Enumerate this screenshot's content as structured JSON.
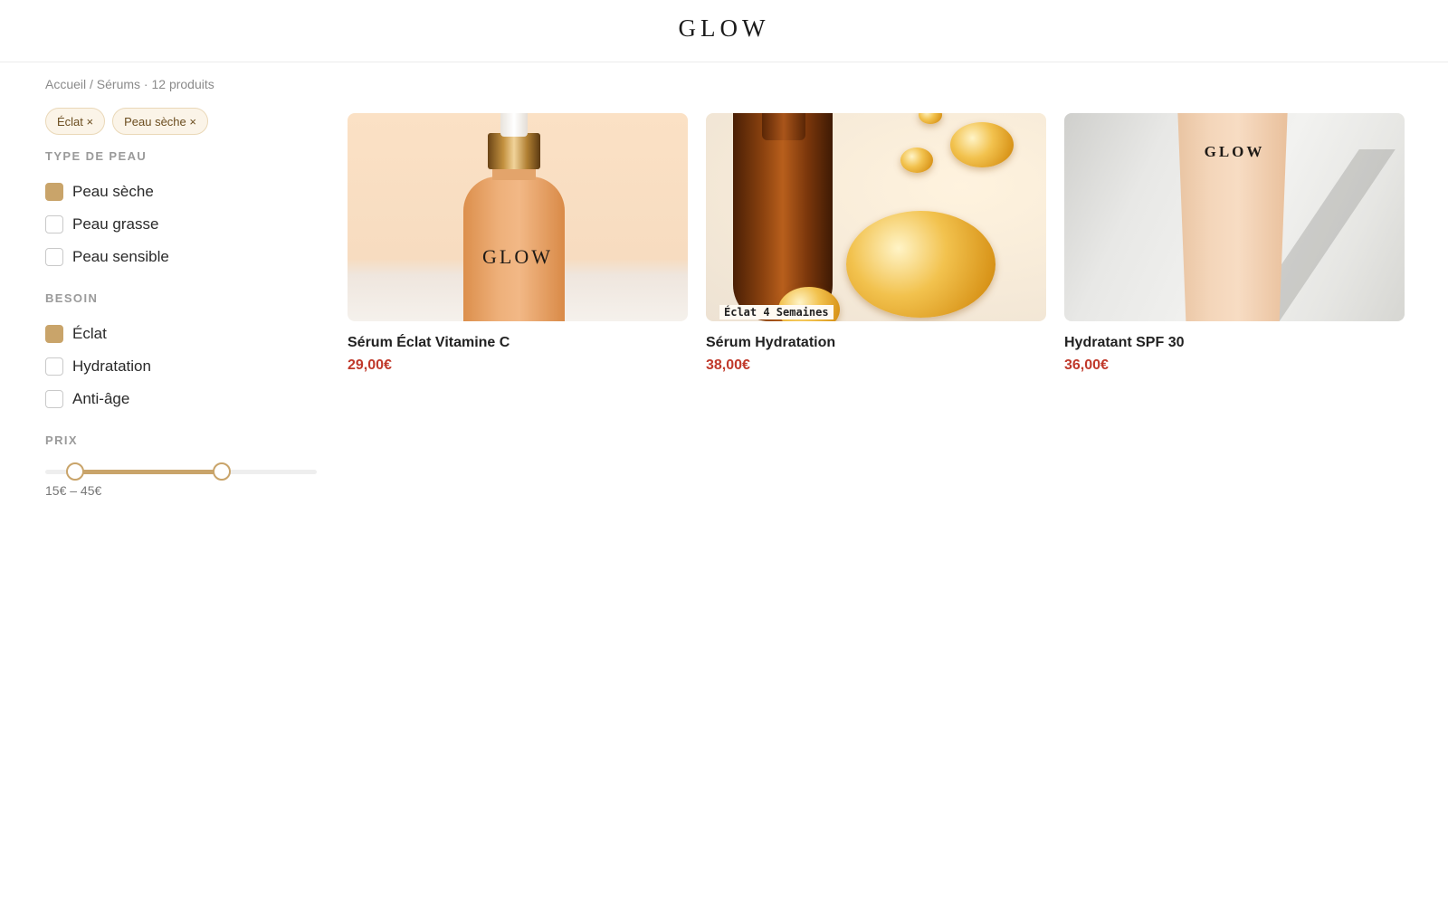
{
  "header": {
    "logo": "GLOW"
  },
  "breadcrumb": "Accueil / Sérums · 12 produits",
  "active_filters": [
    "Éclat ×",
    "Peau sèche ×"
  ],
  "filters": {
    "skin_type": {
      "title": "TYPE DE PEAU",
      "options": [
        {
          "label": "Peau sèche",
          "checked": true
        },
        {
          "label": "Peau grasse",
          "checked": false
        },
        {
          "label": "Peau sensible",
          "checked": false
        }
      ]
    },
    "need": {
      "title": "BESOIN",
      "options": [
        {
          "label": "Éclat",
          "checked": true
        },
        {
          "label": "Hydratation",
          "checked": false
        },
        {
          "label": "Anti-âge",
          "checked": false
        }
      ]
    },
    "price": {
      "title": "PRIX",
      "range_label": "15€ – 45€",
      "min_value": 15,
      "max_value": 45,
      "min_fraction": 0.11,
      "max_fraction": 0.65
    }
  },
  "products": [
    {
      "name": "Sérum Éclat Vitamine C",
      "price": "29,00€",
      "image_label": "GLOW",
      "image_icon": "amber-dropper-bottle"
    },
    {
      "name": "Sérum Hydratation",
      "price": "38,00€",
      "image_label": "Éclat 4 Semaines",
      "image_icon": "serum-drops-bottle"
    },
    {
      "name": "Hydratant SPF 30",
      "price": "36,00€",
      "image_label": "GLOW",
      "image_icon": "nude-tube"
    }
  ],
  "colors": {
    "accent": "#c9a46a",
    "price": "#c0392b",
    "chip_bg": "#fbf4e8",
    "chip_border": "#ead8b8",
    "chip_text": "#6b4d1f"
  }
}
